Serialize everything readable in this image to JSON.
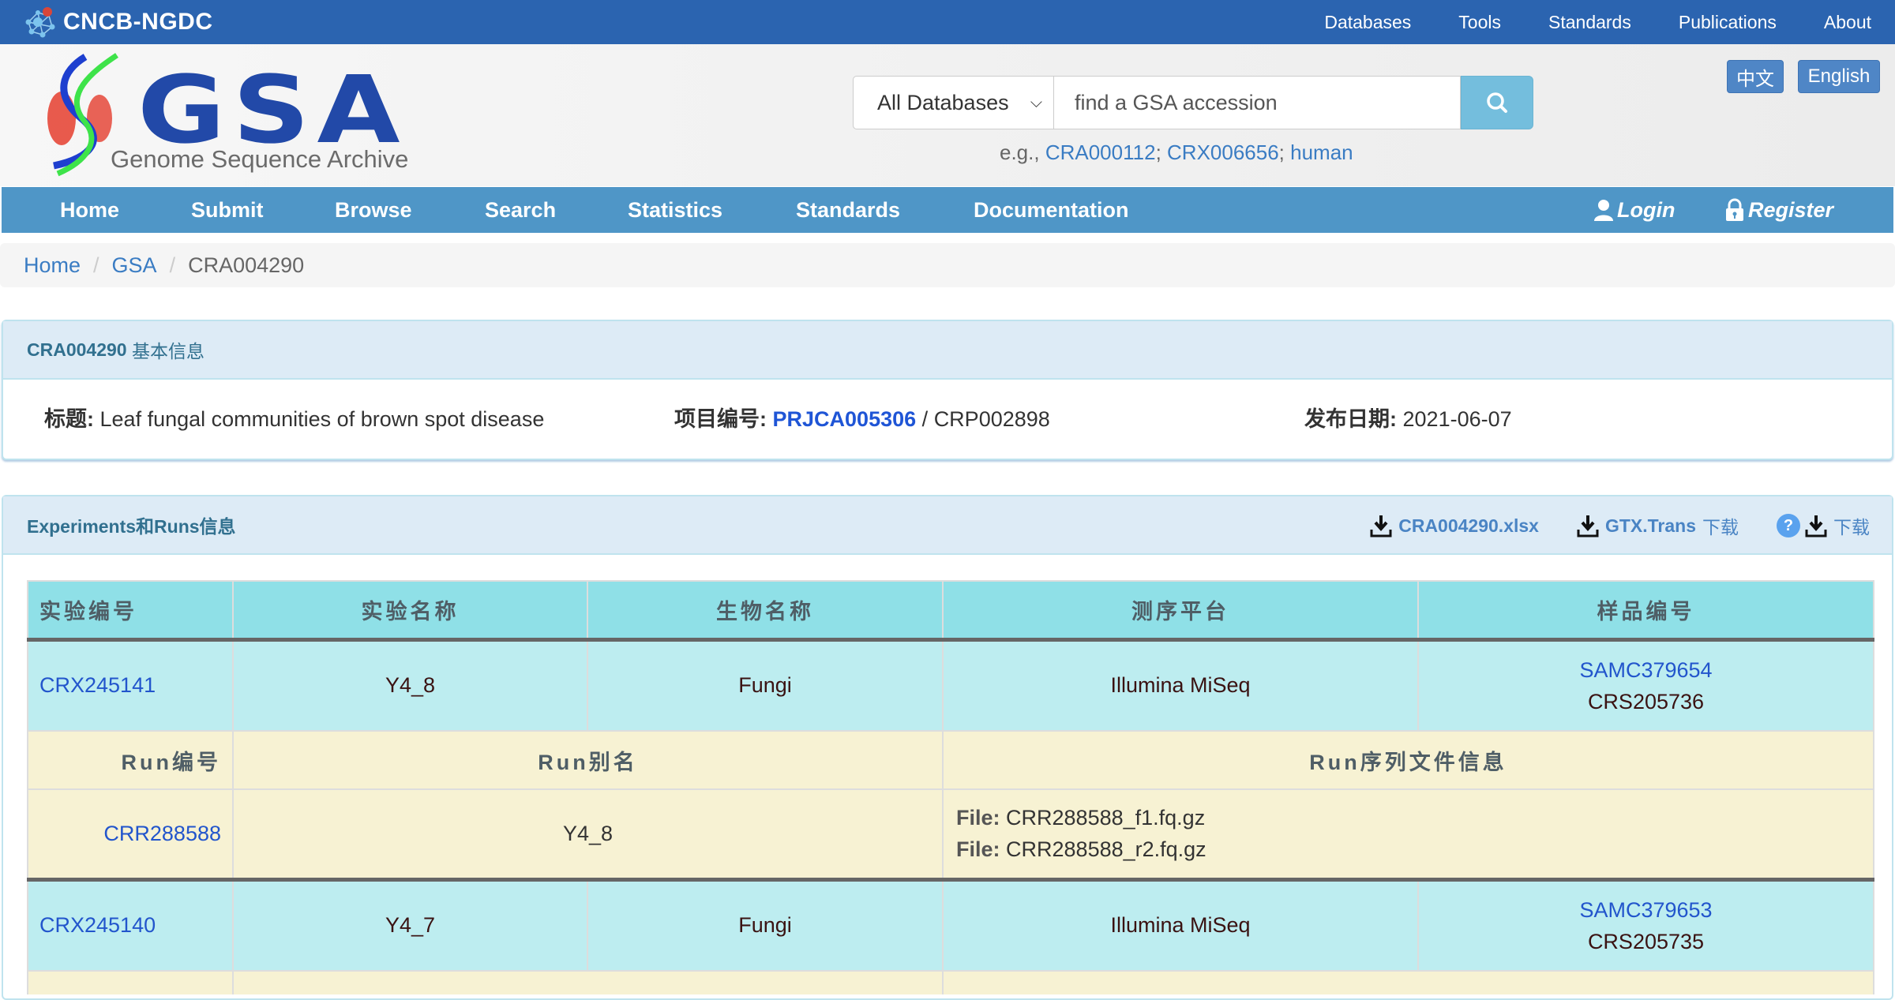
{
  "topbar": {
    "brand": "CNCB-NGDC",
    "links": [
      "Databases",
      "Tools",
      "Standards",
      "Publications",
      "About"
    ]
  },
  "header": {
    "logo_title": "GSA",
    "logo_subtitle": "Genome Sequence Archive",
    "search": {
      "database_select": "All Databases",
      "placeholder": "find a GSA accession",
      "examples_prefix": "e.g.,",
      "examples": [
        "CRA000112",
        "CRX006656",
        "human"
      ]
    },
    "languages": [
      "中文",
      "English"
    ]
  },
  "nav": {
    "items": [
      "Home",
      "Submit",
      "Browse",
      "Search",
      "Statistics",
      "Standards",
      "Documentation"
    ],
    "login": "Login",
    "register": "Register"
  },
  "breadcrumb": [
    "Home",
    "GSA",
    "CRA004290"
  ],
  "basic_info": {
    "heading_id": "CRA004290",
    "heading_label": "基本信息",
    "title_label": "标题:",
    "title_value": "Leaf fungal communities of brown spot disease",
    "project_label": "项目编号:",
    "project_id": "PRJCA005306",
    "project_sep": "/",
    "project_alt": "CRP002898",
    "release_label": "发布日期:",
    "release_date": "2021-06-07"
  },
  "experiments": {
    "heading": "Experiments和Runs信息",
    "downloads": {
      "xlsx": "CRA004290.xlsx",
      "gtx_label": "GTX.Trans",
      "gtx_suffix": "下载",
      "download": "下载"
    },
    "exp_headers": [
      "实验编号",
      "实验名称",
      "生物名称",
      "测序平台",
      "样品编号"
    ],
    "run_headers": [
      "Run编号",
      "Run别名",
      "Run序列文件信息"
    ],
    "file_label": "File:",
    "rows": [
      {
        "accession": "CRX245141",
        "name": "Y4_8",
        "organism": "Fungi",
        "platform": "Illumina MiSeq",
        "sample": "SAMC379654",
        "sample_alt": "CRS205736",
        "run": {
          "accession": "CRR288588",
          "alias": "Y4_8",
          "files": [
            "CRR288588_f1.fq.gz",
            "CRR288588_r2.fq.gz"
          ]
        }
      },
      {
        "accession": "CRX245140",
        "name": "Y4_7",
        "organism": "Fungi",
        "platform": "Illumina MiSeq",
        "sample": "SAMC379653",
        "sample_alt": "CRS205735"
      }
    ]
  }
}
